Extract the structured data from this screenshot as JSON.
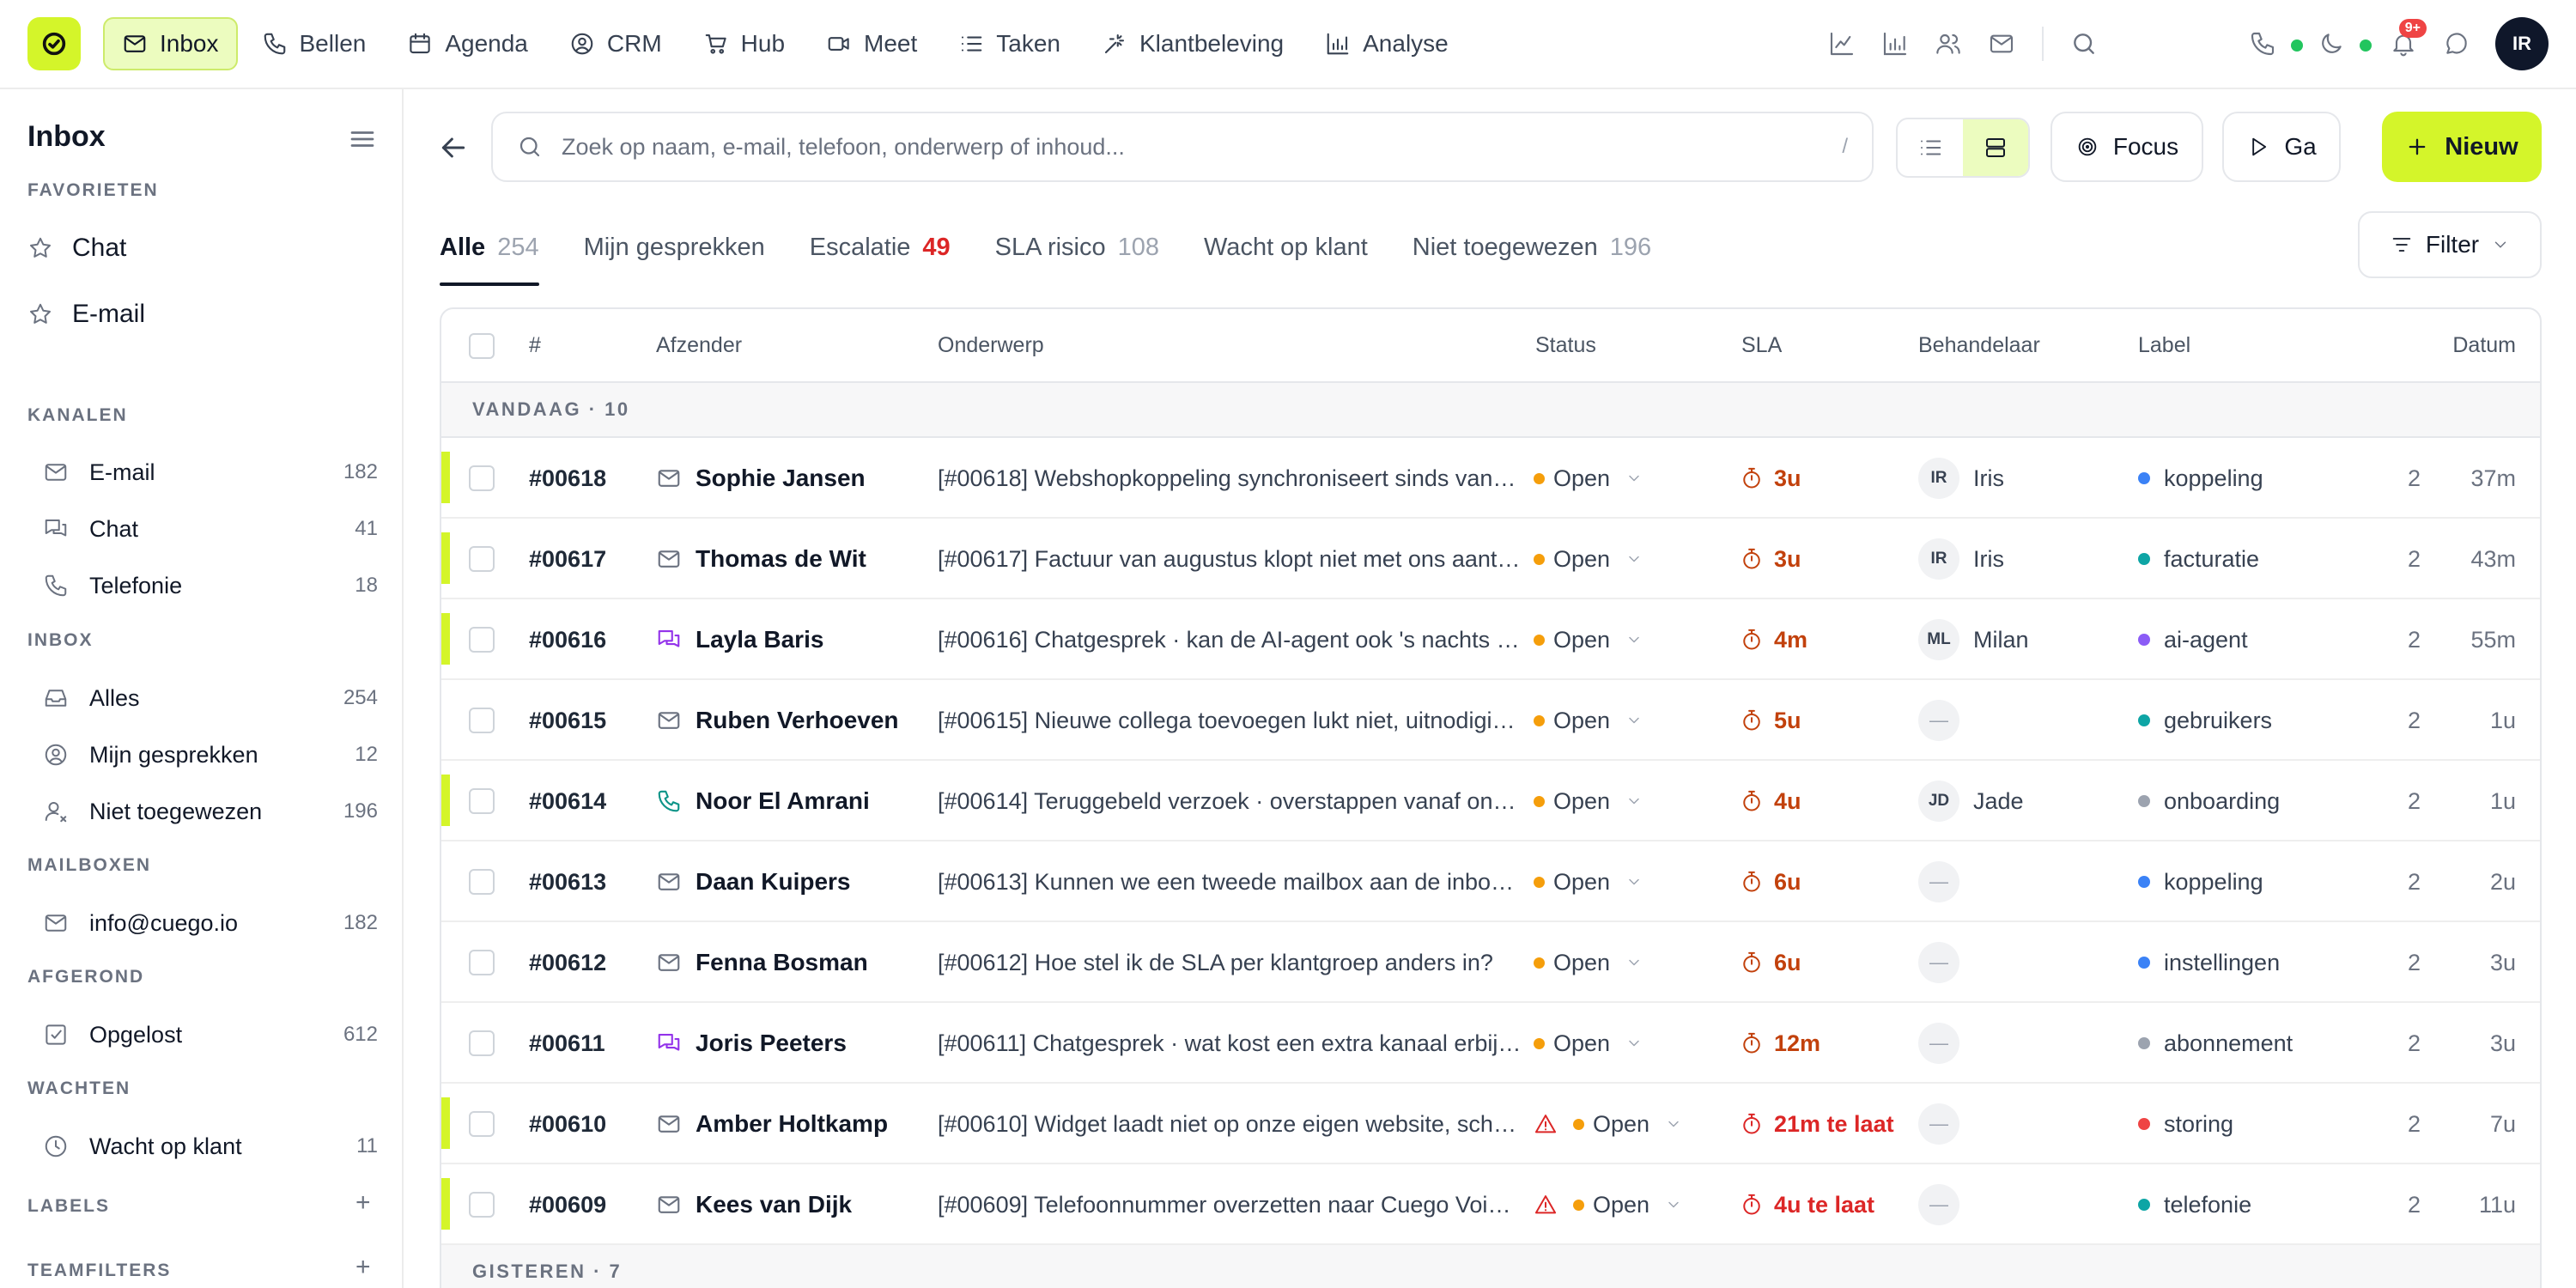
{
  "colors": {
    "accent": "#d4f52a",
    "status_open": "#f59e0b",
    "sla_warn": "#c2410c",
    "sla_late": "#dc2626",
    "unread_bar": "#d4f52a"
  },
  "topnav": {
    "items": [
      {
        "label": "Inbox",
        "icon": "mail-icon",
        "active": true
      },
      {
        "label": "Bellen",
        "icon": "phone-icon"
      },
      {
        "label": "Agenda",
        "icon": "calendar-icon"
      },
      {
        "label": "CRM",
        "icon": "user-circle-icon"
      },
      {
        "label": "Hub",
        "icon": "cart-icon"
      },
      {
        "label": "Meet",
        "icon": "video-icon"
      },
      {
        "label": "Taken",
        "icon": "list-icon"
      },
      {
        "label": "Klantbeleving",
        "icon": "sparkle-icon"
      },
      {
        "label": "Analyse",
        "icon": "bar-chart-icon"
      }
    ],
    "notification_count": "9+",
    "user_initials": "IR"
  },
  "sidebar": {
    "title": "Inbox",
    "sections": {
      "favorites": "FAVORIETEN",
      "channels": "KANALEN",
      "inbox": "INBOX",
      "mailboxes": "MAILBOXEN",
      "resolved": "AFGEROND",
      "waiting": "WACHTEN",
      "labels": "LABELS",
      "teamfilters": "TEAMFILTERS"
    },
    "favorites": [
      {
        "label": "Chat"
      },
      {
        "label": "E-mail"
      }
    ],
    "channels": [
      {
        "label": "E-mail",
        "count": "182",
        "icon": "mail-icon"
      },
      {
        "label": "Chat",
        "count": "41",
        "icon": "chat-icon"
      },
      {
        "label": "Telefonie",
        "count": "18",
        "icon": "phone-icon"
      }
    ],
    "inbox": [
      {
        "label": "Alles",
        "count": "254",
        "icon": "inbox-icon"
      },
      {
        "label": "Mijn gesprekken",
        "count": "12",
        "icon": "user-circle-icon"
      },
      {
        "label": "Niet toegewezen",
        "count": "196",
        "icon": "user-icon"
      }
    ],
    "mailboxes": [
      {
        "label": "info@cuego.io",
        "count": "182",
        "icon": "mail-icon"
      }
    ],
    "resolved": [
      {
        "label": "Opgelost",
        "count": "612",
        "icon": "check-square-icon"
      }
    ],
    "waiting": [
      {
        "label": "Wacht op klant",
        "count": "11",
        "icon": "clock-icon"
      }
    ],
    "add_symbol": "+"
  },
  "toolbar": {
    "search_placeholder": "Zoek op naam, e-mail, telefoon, onderwerp of inhoud...",
    "search_shortcut": "/",
    "focus_label": "Focus",
    "go_label": "Ga",
    "new_label": "Nieuw"
  },
  "tabs": [
    {
      "label": "Alle",
      "count": "254",
      "active": true
    },
    {
      "label": "Mijn gesprekken",
      "count": ""
    },
    {
      "label": "Escalatie",
      "count": "49",
      "alert": true
    },
    {
      "label": "SLA risico",
      "count": "108"
    },
    {
      "label": "Wacht op klant",
      "count": ""
    },
    {
      "label": "Niet toegewezen",
      "count": "196"
    }
  ],
  "filter_label": "Filter",
  "table": {
    "headers": {
      "id": "#",
      "sender": "Afzender",
      "subject": "Onderwerp",
      "status": "Status",
      "sla": "SLA",
      "owner": "Behandelaar",
      "label": "Label",
      "date": "Datum"
    },
    "groups": {
      "today": "VANDAAG · 10",
      "yesterday": "GISTEREN · 7"
    },
    "rows": [
      {
        "id": "#00618",
        "channel": "mail",
        "sender": "Sophie Jansen",
        "subject": "[#00618] Webshopkoppeling synchroniseert sinds vanochtend niet meer",
        "status": "Open",
        "sla": "3u",
        "sla_late": false,
        "warn": false,
        "owner_initials": "IR",
        "owner": "Iris",
        "label": "koppeling",
        "label_color": "#3b82f6",
        "count": "2",
        "date": "37m",
        "unread": true
      },
      {
        "id": "#00617",
        "channel": "mail",
        "sender": "Thomas de Wit",
        "subject": "[#00617] Factuur van augustus klopt niet met ons aantal gebruikers",
        "status": "Open",
        "sla": "3u",
        "sla_late": false,
        "warn": false,
        "owner_initials": "IR",
        "owner": "Iris",
        "label": "facturatie",
        "label_color": "#0ea5a5",
        "count": "2",
        "date": "43m",
        "unread": true
      },
      {
        "id": "#00616",
        "channel": "chat",
        "sender": "Layla Baris",
        "subject": "[#00616] Chatgesprek · kan de AI-agent ook 's nachts antwoorden?",
        "status": "Open",
        "sla": "4m",
        "sla_late": false,
        "warn": false,
        "owner_initials": "ML",
        "owner": "Milan",
        "label": "ai-agent",
        "label_color": "#8b5cf6",
        "count": "2",
        "date": "55m",
        "unread": true
      },
      {
        "id": "#00615",
        "channel": "mail",
        "sender": "Ruben Verhoeven",
        "subject": "[#00615] Nieuwe collega toevoegen lukt niet, uitnodiging komt niet aan",
        "status": "Open",
        "sla": "5u",
        "sla_late": false,
        "warn": false,
        "owner_initials": "—",
        "owner": "",
        "label": "gebruikers",
        "label_color": "#0ea5a5",
        "count": "2",
        "date": "1u",
        "unread": false
      },
      {
        "id": "#00614",
        "channel": "phone",
        "sender": "Noor El Amrani",
        "subject": "[#00614] Teruggebeld verzoek · overstappen vanaf ons oude pakket",
        "status": "Open",
        "sla": "4u",
        "sla_late": false,
        "warn": false,
        "owner_initials": "JD",
        "owner": "Jade",
        "label": "onboarding",
        "label_color": "#9ca3af",
        "count": "2",
        "date": "1u",
        "unread": true
      },
      {
        "id": "#00613",
        "channel": "mail",
        "sender": "Daan Kuipers",
        "subject": "[#00613] Kunnen we een tweede mailbox aan de inbox koppelen?",
        "status": "Open",
        "sla": "6u",
        "sla_late": false,
        "warn": false,
        "owner_initials": "—",
        "owner": "",
        "label": "koppeling",
        "label_color": "#3b82f6",
        "count": "2",
        "date": "2u",
        "unread": false
      },
      {
        "id": "#00612",
        "channel": "mail",
        "sender": "Fenna Bosman",
        "subject": "[#00612] Hoe stel ik de SLA per klantgroep anders in?",
        "status": "Open",
        "sla": "6u",
        "sla_late": false,
        "warn": false,
        "owner_initials": "—",
        "owner": "",
        "label": "instellingen",
        "label_color": "#3b82f6",
        "count": "2",
        "date": "3u",
        "unread": false
      },
      {
        "id": "#00611",
        "channel": "chat",
        "sender": "Joris Peeters",
        "subject": "[#00611] Chatgesprek · wat kost een extra kanaal erbij per maand?",
        "status": "Open",
        "sla": "12m",
        "sla_late": false,
        "warn": false,
        "owner_initials": "—",
        "owner": "",
        "label": "abonnement",
        "label_color": "#9ca3af",
        "count": "2",
        "date": "3u",
        "unread": false
      },
      {
        "id": "#00610",
        "channel": "mail",
        "sender": "Amber Holtkamp",
        "subject": "[#00610] Widget laadt niet op onze eigen website, scherm blijft wit",
        "status": "Open",
        "sla": "21m te laat",
        "sla_late": true,
        "warn": true,
        "owner_initials": "—",
        "owner": "",
        "label": "storing",
        "label_color": "#ef4444",
        "count": "2",
        "date": "7u",
        "unread": true
      },
      {
        "id": "#00609",
        "channel": "mail",
        "sender": "Kees van Dijk",
        "subject": "[#00609] Telefoonnummer overzetten naar Cuego Voice, hoe lang duurt dat?",
        "status": "Open",
        "sla": "4u te laat",
        "sla_late": true,
        "warn": true,
        "owner_initials": "—",
        "owner": "",
        "label": "telefonie",
        "label_color": "#0ea5a5",
        "count": "2",
        "date": "11u",
        "unread": true
      }
    ]
  }
}
